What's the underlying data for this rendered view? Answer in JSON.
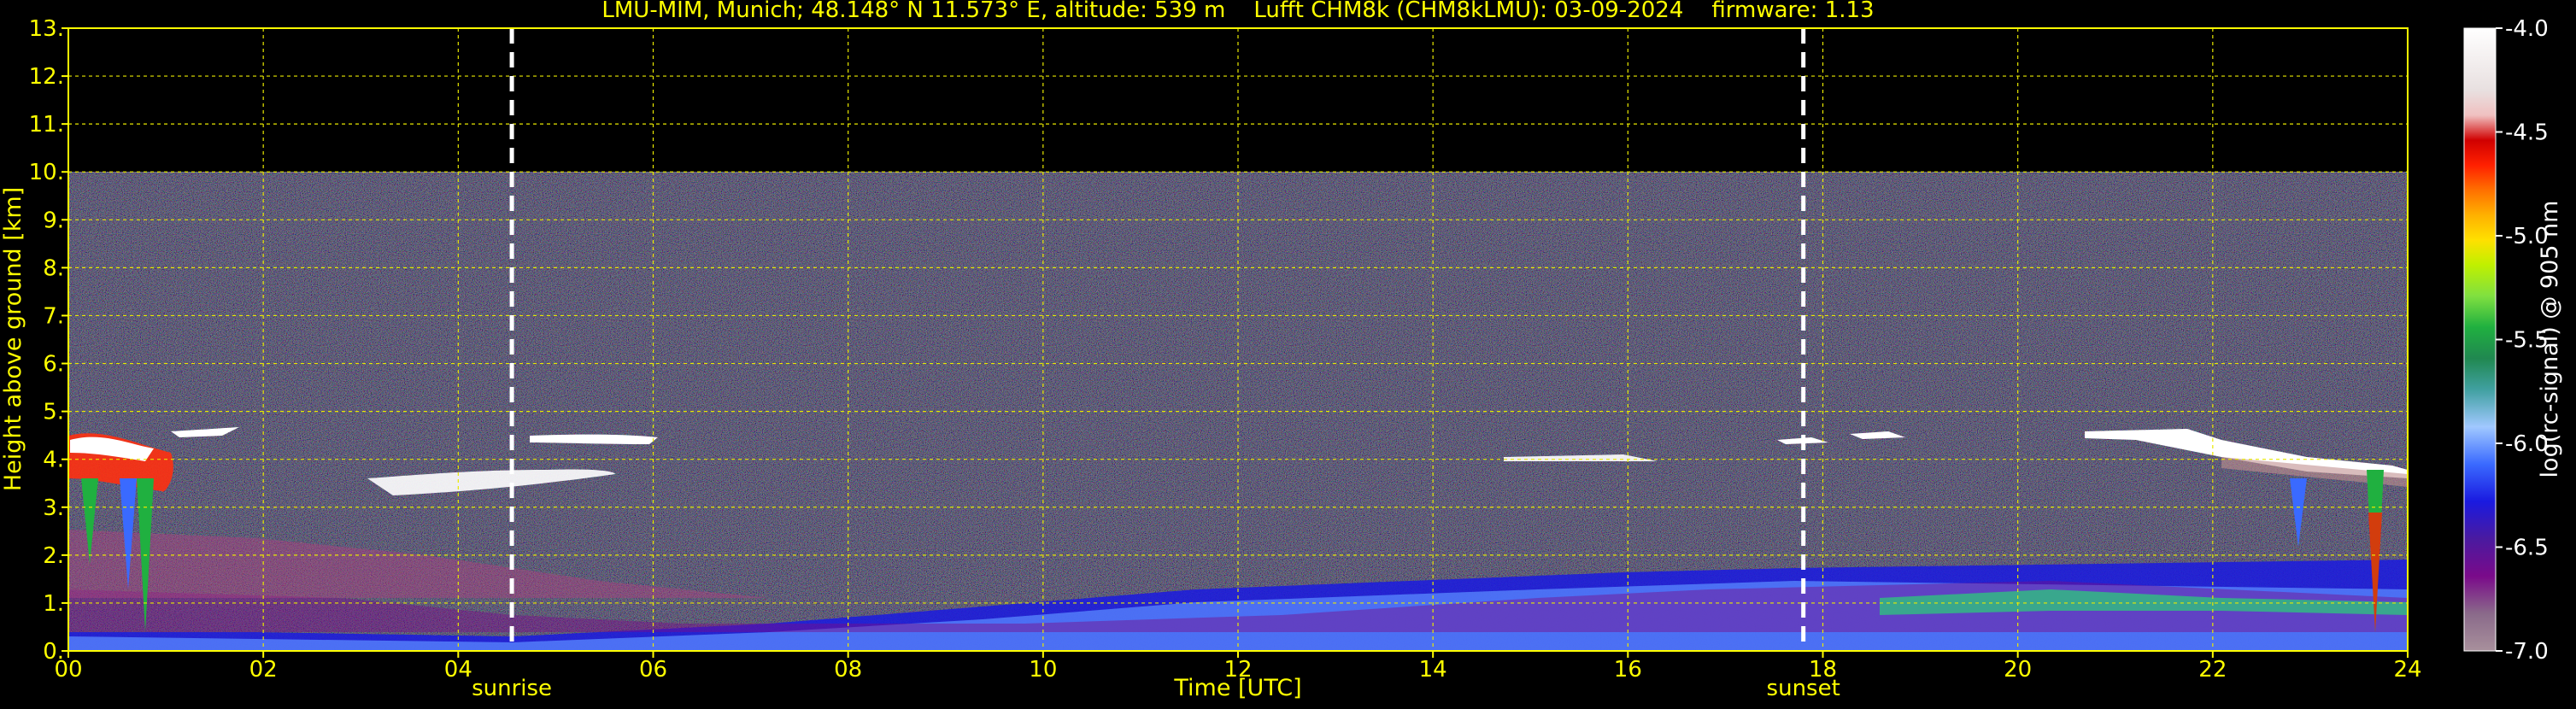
{
  "chart_data": {
    "type": "heatmap",
    "title": "LMU-MIM, Munich; 48.148° N 11.573° E, altitude: 539 m    Lufft CHM8k (CHM8kLMU): 03-09-2024    firmware: 1.13",
    "xlabel": "Time [UTC]",
    "ylabel": "Height above ground [km]",
    "colorbar_label": "log(rc-signal) @ 905 nm",
    "xlim": [
      0,
      24
    ],
    "ylim": [
      0,
      13
    ],
    "clim": [
      -7.0,
      -4.0
    ],
    "x_ticks": [
      "00",
      "02",
      "04",
      "06",
      "08",
      "10",
      "12",
      "14",
      "16",
      "18",
      "20",
      "22",
      "24"
    ],
    "y_ticks": [
      "0.",
      "1.",
      "2.",
      "3.",
      "4.",
      "5.",
      "6.",
      "7.",
      "8.",
      "9.",
      "10.",
      "11.",
      "12.",
      "13."
    ],
    "colorbar_ticks": [
      "-4.0",
      "-4.5",
      "-5.0",
      "-5.5",
      "-6.0",
      "-6.5",
      "-7.0"
    ],
    "colormap": [
      "#a8909c",
      "#8a6a8a",
      "#6b3a7a",
      "#7a0a8a",
      "#4a1aa0",
      "#1a1ae0",
      "#3a6aff",
      "#7aa8ff",
      "#a0c8ff",
      "#40a0a0",
      "#208850",
      "#20b040",
      "#80e040",
      "#c0f000",
      "#ffe000",
      "#ffb000",
      "#ff7000",
      "#ff2000",
      "#d00000",
      "#f0c0c0",
      "#e8e0e0",
      "#ffffff"
    ],
    "grid": true,
    "grid_color": "#e8e800",
    "text_color": "#ffff00",
    "data_range_km": [
      0,
      10
    ],
    "markers": [
      {
        "label": "sunrise",
        "x": 4.55
      },
      {
        "label": "sunset",
        "x": 17.8
      }
    ]
  }
}
